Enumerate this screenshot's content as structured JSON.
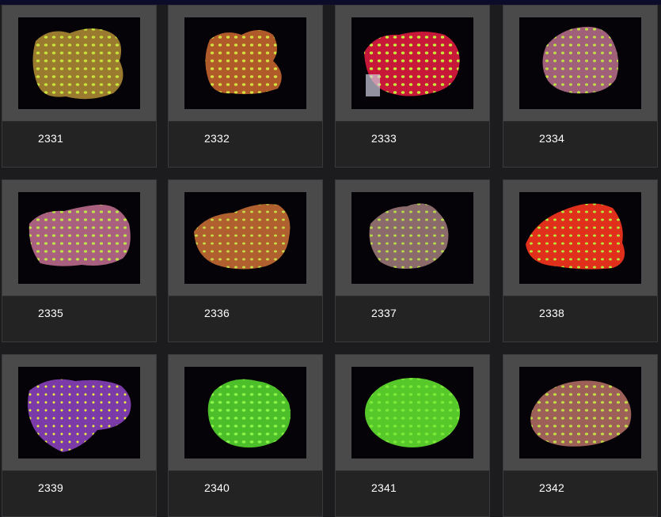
{
  "gallery": {
    "items": [
      {
        "label": "2331",
        "coral": "gold-green"
      },
      {
        "label": "2332",
        "coral": "orange-green"
      },
      {
        "label": "2333",
        "coral": "red-green"
      },
      {
        "label": "2334",
        "coral": "pink-green"
      },
      {
        "label": "2335",
        "coral": "pink-green"
      },
      {
        "label": "2336",
        "coral": "orange-green"
      },
      {
        "label": "2337",
        "coral": "pink-green"
      },
      {
        "label": "2338",
        "coral": "red-green"
      },
      {
        "label": "2339",
        "coral": "purple-yellow"
      },
      {
        "label": "2340",
        "coral": "bright-green"
      },
      {
        "label": "2341",
        "coral": "bright-green"
      },
      {
        "label": "2342",
        "coral": "pink-green"
      }
    ]
  },
  "colors": {
    "background": "#1c1c1e",
    "frame": "#4a4a4b",
    "caption_text": "#ffffff"
  }
}
